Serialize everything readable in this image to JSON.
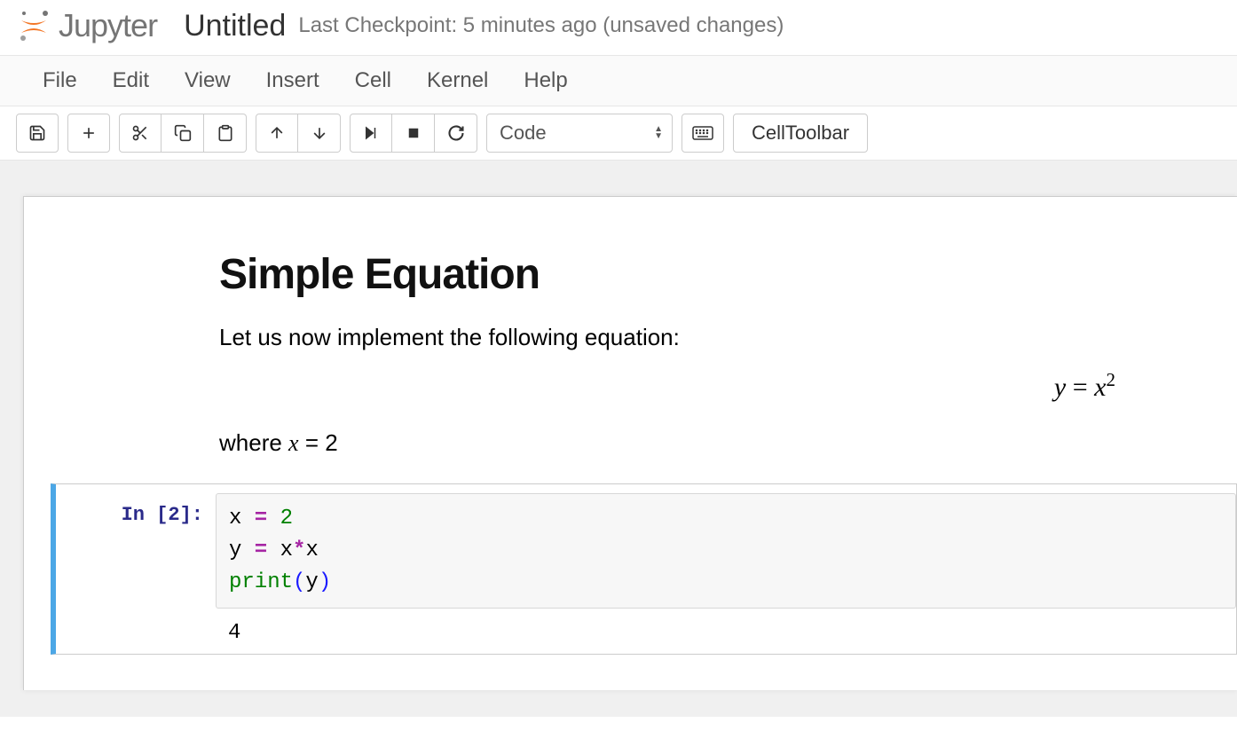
{
  "header": {
    "brand": "Jupyter",
    "title": "Untitled",
    "checkpoint": "Last Checkpoint: 5 minutes ago (unsaved changes)"
  },
  "menu": [
    "File",
    "Edit",
    "View",
    "Insert",
    "Cell",
    "Kernel",
    "Help"
  ],
  "toolbar": {
    "cell_type": "Code",
    "celltoolbar_label": "CellToolbar"
  },
  "markdown": {
    "heading": "Simple Equation",
    "intro": "Let us now implement the following equation:",
    "equation": "y = x²",
    "where_prefix": "where ",
    "where_expr": "x = 2"
  },
  "code_cell": {
    "prompt": "In [2]:",
    "source": {
      "line1_var": "x",
      "line1_op": " = ",
      "line1_val": "2",
      "line2_var": "y",
      "line2_op": " = ",
      "line2_rhs_a": "x",
      "line2_rhs_op": "*",
      "line2_rhs_b": "x",
      "line3_fn": "print",
      "line3_arg": "y"
    },
    "output": "4"
  }
}
